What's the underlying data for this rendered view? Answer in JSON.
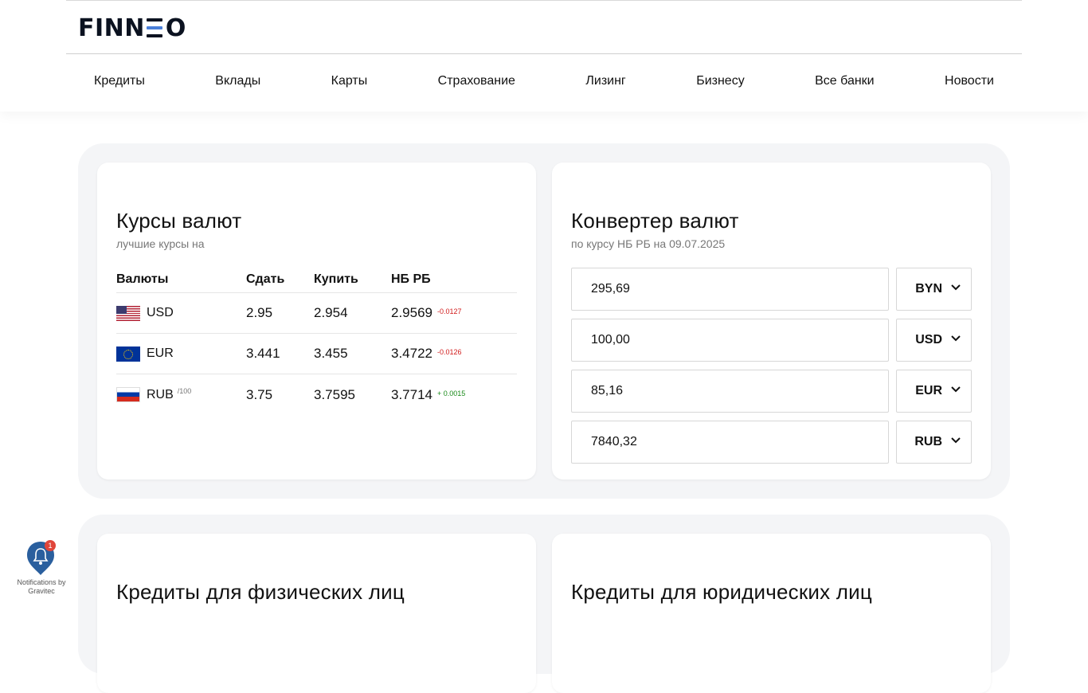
{
  "header": {
    "logo": {
      "left": "FINN",
      "right": "O"
    },
    "nav": [
      "Кредиты",
      "Вклады",
      "Карты",
      "Страхование",
      "Лизинг",
      "Бизнесу",
      "Все банки",
      "Новости"
    ]
  },
  "rates": {
    "title": "Курсы валют",
    "subtitle": "лучшие курсы на",
    "headers": {
      "currency": "Валюты",
      "sell": "Сдать",
      "buy": "Купить",
      "nb": "НБ РБ"
    },
    "rows": [
      {
        "flag_icon": "us-flag-icon",
        "code": "USD",
        "unit": "",
        "sell": "2.95",
        "buy": "2.954",
        "nb": "2.9569",
        "delta": "-0.0127",
        "delta_dir": "neg"
      },
      {
        "flag_icon": "eu-flag-icon",
        "code": "EUR",
        "unit": "",
        "sell": "3.441",
        "buy": "3.455",
        "nb": "3.4722",
        "delta": "-0.0126",
        "delta_dir": "neg"
      },
      {
        "flag_icon": "ru-flag-icon",
        "code": "RUB",
        "unit": "/100",
        "sell": "3.75",
        "buy": "3.7595",
        "nb": "3.7714",
        "delta": "+ 0.0015",
        "delta_dir": "pos"
      }
    ]
  },
  "converter": {
    "title": "Конвертер валют",
    "subtitle_prefix": "по курсу НБ РБ на ",
    "date": "09.07.2025",
    "rows": [
      {
        "amount": "295,69",
        "currency": "BYN"
      },
      {
        "amount": "100,00",
        "currency": "USD"
      },
      {
        "amount": "85,16",
        "currency": "EUR"
      },
      {
        "amount": "7840,32",
        "currency": "RUB"
      }
    ]
  },
  "credits_individuals": {
    "title": "Кредиты для физических лиц"
  },
  "credits_legal": {
    "title": "Кредиты для юридических лиц"
  },
  "gravitec": {
    "badge": "1",
    "label": "Notifications by Gravitec"
  },
  "colors": {
    "accent_blue": "#4a7fd9",
    "section_bg": "#f4f5f7",
    "negative": "#d11a1a",
    "positive": "#1a8a1a",
    "widget_blue": "#2a5f9e"
  }
}
